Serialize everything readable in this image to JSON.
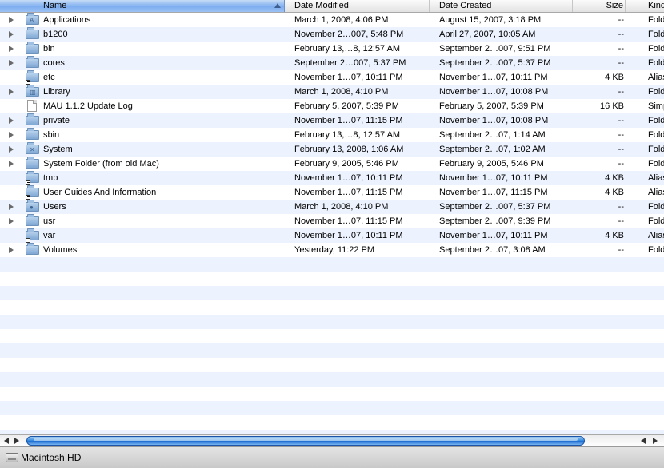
{
  "columns": {
    "name": "Name",
    "date_modified": "Date Modified",
    "date_created": "Date Created",
    "size": "Size",
    "kind": "Kind"
  },
  "rows": [
    {
      "name": "Applications",
      "modified": "March 1, 2008, 4:06 PM",
      "created": "August 15, 2007, 3:18 PM",
      "size": "--",
      "kind": "Folder",
      "expandable": true,
      "icon": "applications-folder-icon"
    },
    {
      "name": "b1200",
      "modified": "November 2…007, 5:48 PM",
      "created": "April 27, 2007, 10:05 AM",
      "size": "--",
      "kind": "Folder",
      "expandable": true,
      "icon": "folder-icon"
    },
    {
      "name": "bin",
      "modified": "February 13,…8, 12:57 AM",
      "created": "September 2…007, 9:51 PM",
      "size": "--",
      "kind": "Folder",
      "expandable": true,
      "icon": "folder-icon"
    },
    {
      "name": "cores",
      "modified": "September 2…007, 5:37 PM",
      "created": "September 2…007, 5:37 PM",
      "size": "--",
      "kind": "Folder",
      "expandable": true,
      "icon": "folder-icon"
    },
    {
      "name": "etc",
      "modified": "November 1…07, 10:11 PM",
      "created": "November 1…07, 10:11 PM",
      "size": "4 KB",
      "kind": "Alias",
      "expandable": false,
      "icon": "alias-folder-icon"
    },
    {
      "name": "Library",
      "modified": "March 1, 2008, 4:10 PM",
      "created": "November 1…07, 10:08 PM",
      "size": "--",
      "kind": "Folder",
      "expandable": true,
      "icon": "library-folder-icon"
    },
    {
      "name": "MAU 1.1.2 Update Log",
      "modified": "February 5, 2007, 5:39 PM",
      "created": "February 5, 2007, 5:39 PM",
      "size": "16 KB",
      "kind": "Simple",
      "expandable": false,
      "icon": "document-icon"
    },
    {
      "name": "private",
      "modified": "November 1…07, 11:15 PM",
      "created": "November 1…07, 10:08 PM",
      "size": "--",
      "kind": "Folder",
      "expandable": true,
      "icon": "folder-icon"
    },
    {
      "name": "sbin",
      "modified": "February 13,…8, 12:57 AM",
      "created": "September 2…07, 1:14 AM",
      "size": "--",
      "kind": "Folder",
      "expandable": true,
      "icon": "folder-icon"
    },
    {
      "name": "System",
      "modified": "February 13, 2008, 1:06 AM",
      "created": "September 2…07, 1:02 AM",
      "size": "--",
      "kind": "Folder",
      "expandable": true,
      "icon": "system-folder-icon"
    },
    {
      "name": "System Folder (from old Mac)",
      "modified": "February 9, 2005, 5:46 PM",
      "created": "February 9, 2005, 5:46 PM",
      "size": "--",
      "kind": "Folder",
      "expandable": true,
      "icon": "folder-icon"
    },
    {
      "name": "tmp",
      "modified": "November 1…07, 10:11 PM",
      "created": "November 1…07, 10:11 PM",
      "size": "4 KB",
      "kind": "Alias",
      "expandable": false,
      "icon": "alias-folder-icon"
    },
    {
      "name": "User Guides And Information",
      "modified": "November 1…07, 11:15 PM",
      "created": "November 1…07, 11:15 PM",
      "size": "4 KB",
      "kind": "Alias",
      "expandable": false,
      "icon": "alias-folder-icon"
    },
    {
      "name": "Users",
      "modified": "March 1, 2008, 4:10 PM",
      "created": "September 2…007, 5:37 PM",
      "size": "--",
      "kind": "Folder",
      "expandable": true,
      "icon": "users-folder-icon"
    },
    {
      "name": "usr",
      "modified": "November 1…07, 11:15 PM",
      "created": "September 2…007, 9:39 PM",
      "size": "--",
      "kind": "Folder",
      "expandable": true,
      "icon": "folder-icon"
    },
    {
      "name": "var",
      "modified": "November 1…07, 10:11 PM",
      "created": "November 1…07, 10:11 PM",
      "size": "4 KB",
      "kind": "Alias",
      "expandable": false,
      "icon": "alias-folder-icon"
    },
    {
      "name": "Volumes",
      "modified": "Yesterday, 11:22 PM",
      "created": "September 2…07, 3:08 AM",
      "size": "--",
      "kind": "Folder",
      "expandable": true,
      "icon": "folder-icon"
    }
  ],
  "statusbar": {
    "path": "Macintosh HD"
  },
  "colors": {
    "sorted_header": "#7eaef0",
    "stripe": "#edf3fe",
    "scroll_thumb": "#3a8fe2"
  }
}
